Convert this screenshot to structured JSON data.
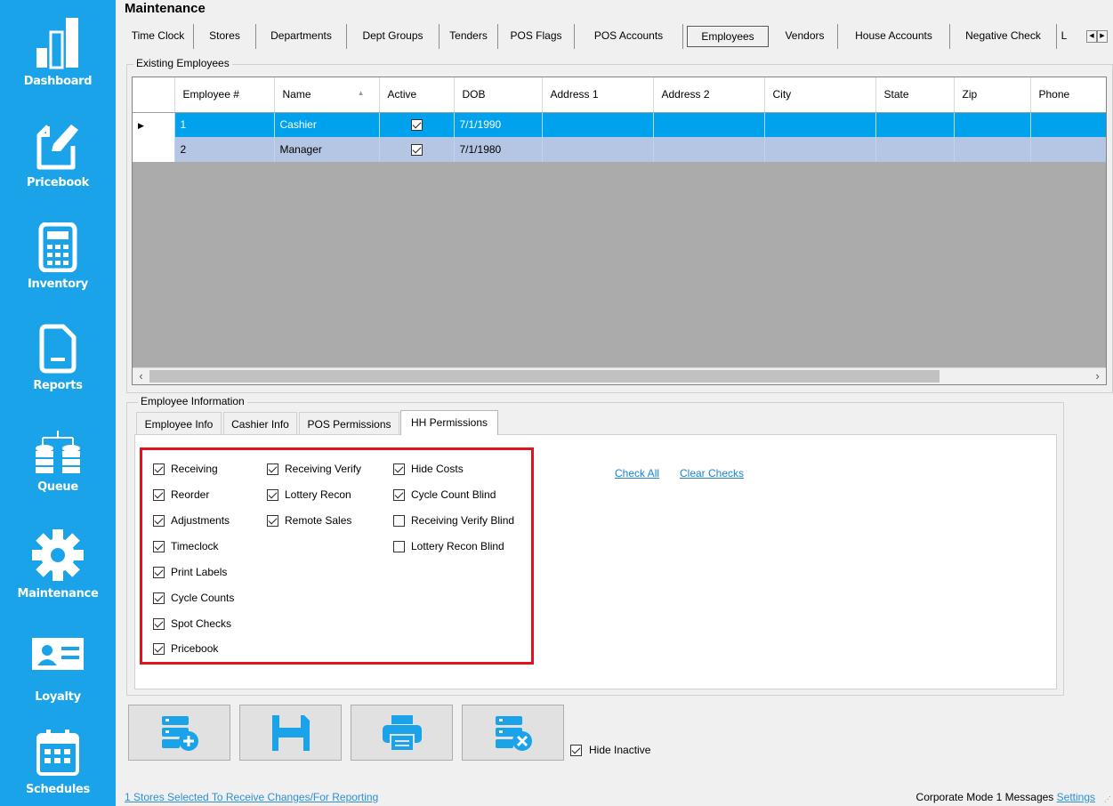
{
  "sidebar": {
    "items": [
      {
        "label": "Dashboard",
        "icon": "bar-chart-icon"
      },
      {
        "label": "Pricebook",
        "icon": "edit-document-icon"
      },
      {
        "label": "Inventory",
        "icon": "calculator-icon"
      },
      {
        "label": "Reports",
        "icon": "report-document-icon"
      },
      {
        "label": "Queue",
        "icon": "database-queue-icon"
      },
      {
        "label": "Maintenance",
        "icon": "gear-icon"
      },
      {
        "label": "Loyalty",
        "icon": "id-card-icon"
      },
      {
        "label": "Schedules",
        "icon": "calendar-icon"
      }
    ]
  },
  "header": {
    "title": "Maintenance",
    "tabs": [
      "Time Clock",
      "Stores",
      "Departments",
      "Dept Groups",
      "Tenders",
      "POS Flags",
      "POS Accounts",
      "Employees",
      "Vendors",
      "House Accounts",
      "Negative Check",
      "L"
    ],
    "active_tab": "Employees"
  },
  "existing_employees": {
    "group_title": "Existing Employees",
    "columns": [
      "Employee #",
      "Name",
      "Active",
      "DOB",
      "Address 1",
      "Address 2",
      "City",
      "State",
      "Zip",
      "Phone"
    ],
    "rows": [
      {
        "employee_no": "1",
        "name": "Cashier",
        "active": true,
        "dob": "7/1/1990",
        "selected": true
      },
      {
        "employee_no": "2",
        "name": "Manager",
        "active": true,
        "dob": "7/1/1980",
        "selected": false
      }
    ]
  },
  "employee_information": {
    "group_title": "Employee Information",
    "tabs": [
      "Employee Info",
      "Cashier Info",
      "POS Permissions",
      "HH Permissions"
    ],
    "active_tab": "HH Permissions",
    "permissions": [
      {
        "label": "Receiving",
        "checked": true
      },
      {
        "label": "Reorder",
        "checked": true
      },
      {
        "label": "Adjustments",
        "checked": true
      },
      {
        "label": "Timeclock",
        "checked": true
      },
      {
        "label": "Print Labels",
        "checked": true
      },
      {
        "label": "Cycle Counts",
        "checked": true
      },
      {
        "label": "Spot Checks",
        "checked": true
      },
      {
        "label": "Pricebook",
        "checked": true
      },
      {
        "label": "Receiving Verify",
        "checked": true
      },
      {
        "label": "Lottery Recon",
        "checked": true
      },
      {
        "label": "Remote Sales",
        "checked": true
      },
      {
        "label": "Hide Costs",
        "checked": true
      },
      {
        "label": "Cycle Count Blind",
        "checked": true
      },
      {
        "label": "Receiving Verify Blind",
        "checked": false
      },
      {
        "label": "Lottery Recon Blind",
        "checked": false
      }
    ],
    "check_all": "Check All",
    "clear_checks": "Clear Checks"
  },
  "actions": {
    "buttons": [
      {
        "name": "add-employee-button",
        "icon": "database-add-icon"
      },
      {
        "name": "save-button",
        "icon": "floppy-disk-icon"
      },
      {
        "name": "print-button",
        "icon": "printer-icon"
      },
      {
        "name": "delete-employee-button",
        "icon": "database-delete-icon"
      }
    ],
    "hide_inactive_label": "Hide Inactive",
    "hide_inactive_checked": true
  },
  "status_bar": {
    "stores_link": "1 Stores Selected To Receive Changes/For Reporting",
    "mode": "Corporate Mode",
    "messages": "1 Messages",
    "settings": "Settings"
  },
  "colors": {
    "sidebar": "#1aa3e8",
    "selected_row": "#00a2ed",
    "alt_row": "#b4c6e4",
    "highlight_border": "#e3111b",
    "link": "#1a82d6"
  }
}
